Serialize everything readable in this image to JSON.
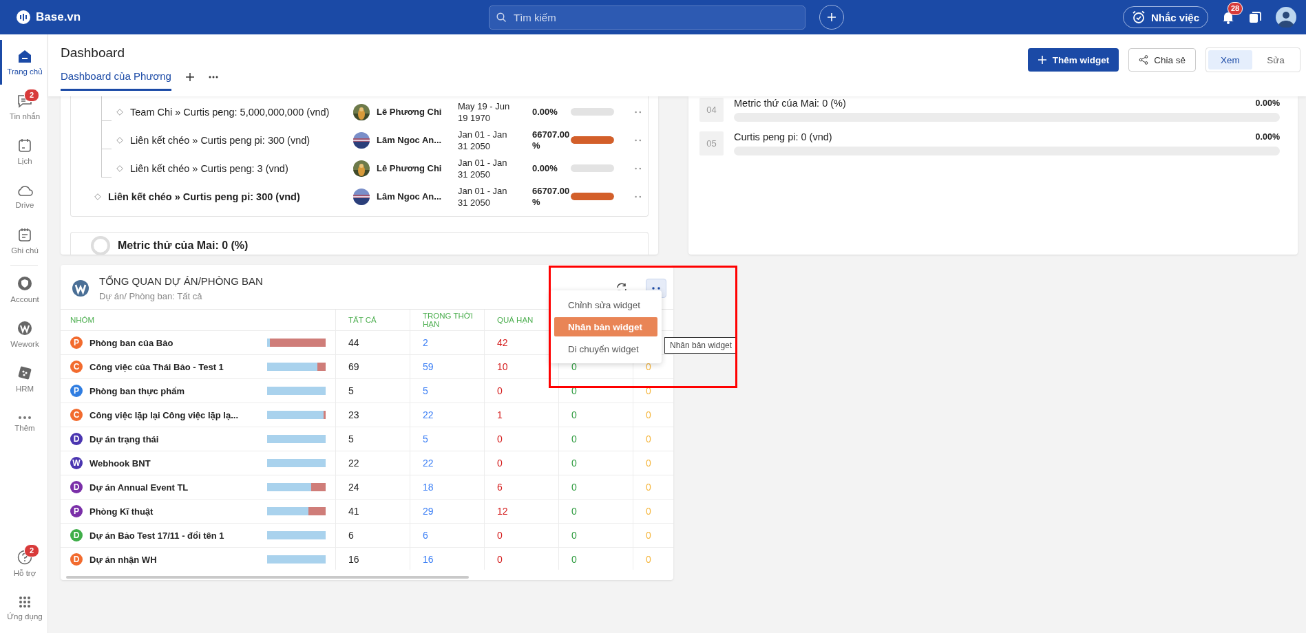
{
  "topbar": {
    "logo": "Base.vn",
    "search": {
      "placeholder": "Tìm kiếm"
    },
    "reminder": "Nhắc việc",
    "notifications": "28"
  },
  "sidebar": {
    "items": [
      {
        "kind": "home",
        "label": "Trang chủ",
        "selected": true
      },
      {
        "kind": "chat",
        "label": "Tin nhắn",
        "selected": false,
        "badge": "2"
      },
      {
        "kind": "calendar",
        "label": "Lịch",
        "selected": false
      },
      {
        "kind": "cloud",
        "label": "Drive",
        "selected": false
      },
      {
        "kind": "note",
        "label": "Ghi chú",
        "selected": false
      },
      {
        "kind": "shield",
        "label": "Account",
        "selected": false
      },
      {
        "kind": "wework",
        "label": "Wework",
        "selected": false
      },
      {
        "kind": "dice",
        "label": "HRM",
        "selected": false
      },
      {
        "kind": "more",
        "label": "Thêm",
        "selected": false
      }
    ],
    "bottom_items": [
      {
        "kind": "help",
        "label": "Hỗ trợ",
        "selected": false,
        "badge": "2"
      },
      {
        "kind": "apps",
        "label": "Ứng dụng",
        "selected": false
      }
    ]
  },
  "header": {
    "title": "Dashboard",
    "tabs": [
      {
        "label": "Dashboard của Phương",
        "selected": true
      }
    ],
    "add_widget": "Thêm widget",
    "share": "Chia sẻ",
    "modes": [
      {
        "label": "Xem",
        "selected": true
      },
      {
        "label": "Sửa",
        "selected": false
      }
    ]
  },
  "goals_widget": {
    "rows": [
      {
        "kind": "sub",
        "title": "Team Chi » Curtis peng: 5,000,000,000 (vnd)",
        "owner": "Lê Phương Chi",
        "dates": "May 19 - Jun 19 1970",
        "percent": "0.00%",
        "level": 0
      },
      {
        "kind": "sub",
        "title": "Liên kết chéo » Curtis peng pi: 300 (vnd)",
        "owner": "Lâm Ngoc An...",
        "dates": "Jan 01 - Jan 31 2050",
        "percent": "66707.00%",
        "level": 1
      },
      {
        "kind": "sub",
        "title": "Liên kết chéo » Curtis peng: 3 (vnd)",
        "owner": "Lê Phương Chi",
        "dates": "Jan 01 - Jan 31 2050",
        "percent": "0.00%",
        "level": 0
      },
      {
        "kind": "main",
        "title": "Liên kết chéo » Curtis peng pi: 300 (vnd)",
        "owner": "Lâm Ngoc An...",
        "dates": "Jan 01 - Jan 31 2050",
        "percent": "66707.00%",
        "level": 1
      }
    ],
    "next_card": {
      "title": "Metric thử của Mai: 0 (%)"
    }
  },
  "metrics_widget": {
    "rows": [
      {
        "index": "04",
        "title": "Metric thứ cúa Mai: 0 (%)",
        "percent": "0.00%",
        "level": 0
      },
      {
        "index": "05",
        "title": "Curtis peng pi: 0 (vnd)",
        "percent": "0.00%",
        "level": 0
      }
    ]
  },
  "overview_widget": {
    "title": "TỔNG QUAN DỰ ÁN/PHÒNG BAN",
    "subtitle": "Dự án/ Phòng ban: Tất cả",
    "columns": [
      "NHÓM",
      "TẤT CẢ",
      "TRONG THỜI HẠN",
      "QUÁ HẠN"
    ],
    "rows": [
      {
        "letter": "P",
        "color": "#f26b2e",
        "name": "Phòng ban của Bảo",
        "level": 0.05,
        "all": "44",
        "on_time": "2",
        "overdue": "42"
      },
      {
        "letter": "C",
        "color": "#f26b2e",
        "name": "Công việc của Thái Bảo - Test 1",
        "level": 0.86,
        "all": "69",
        "on_time": "59",
        "overdue": "10",
        "column_5": "0",
        "column_6": "0"
      },
      {
        "letter": "P",
        "color": "#2f7de1",
        "name": "Phòng ban thực phẩm",
        "level": 1,
        "all": "5",
        "on_time": "5",
        "overdue": "0",
        "column_5": "0",
        "column_6": "0"
      },
      {
        "letter": "C",
        "color": "#f26b2e",
        "name": "Công việc lặp lại Công việc lặp lạ...",
        "level": 0.96,
        "all": "23",
        "on_time": "22",
        "overdue": "1",
        "column_5": "0",
        "column_6": "0"
      },
      {
        "letter": "D",
        "color": "#4a35b0",
        "name": "Dự án trạng thái",
        "level": 1,
        "all": "5",
        "on_time": "5",
        "overdue": "0",
        "column_5": "0",
        "column_6": "0"
      },
      {
        "letter": "W",
        "color": "#4a35b0",
        "name": "Webhook BNT",
        "level": 1,
        "all": "22",
        "on_time": "22",
        "overdue": "0",
        "column_5": "0",
        "column_6": "0"
      },
      {
        "letter": "D",
        "color": "#7a2fa8",
        "name": "Dự án Annual Event TL",
        "level": 0.75,
        "all": "24",
        "on_time": "18",
        "overdue": "6",
        "column_5": "0",
        "column_6": "0"
      },
      {
        "letter": "P",
        "color": "#7a2fa8",
        "name": "Phòng Kĩ thuật",
        "level": 0.71,
        "all": "41",
        "on_time": "29",
        "overdue": "12",
        "column_5": "0",
        "column_6": "0"
      },
      {
        "letter": "D",
        "color": "#3fae49",
        "name": "Dự án Bảo Test 17/11 - đổi tên 1",
        "level": 1,
        "all": "6",
        "on_time": "6",
        "overdue": "0",
        "column_5": "0",
        "column_6": "0"
      },
      {
        "letter": "D",
        "color": "#f26b2e",
        "name": "Dự án nhận WH",
        "level": 1,
        "all": "16",
        "on_time": "16",
        "overdue": "0",
        "column_5": "0",
        "column_6": "0"
      }
    ],
    "menu": [
      {
        "label": "Chỉnh sửa widget",
        "selected": false
      },
      {
        "label": "Nhân bản widget",
        "selected": true
      },
      {
        "label": "Di chuyển widget",
        "selected": false
      }
    ],
    "tooltip": "Nhân bản widget"
  }
}
